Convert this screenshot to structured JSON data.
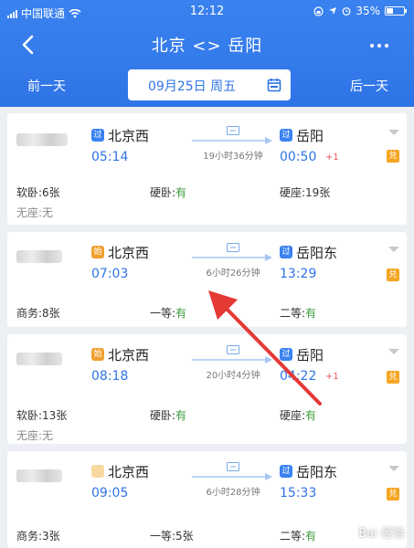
{
  "status_bar": {
    "carrier": "中国联通",
    "time": "12:12",
    "battery": "35%"
  },
  "header": {
    "title": "北京 <> 岳阳",
    "prev_day": "前一天",
    "next_day": "后一天",
    "date": "09月25日 周五"
  },
  "trains": [
    {
      "from_badge": "过",
      "from": "北京西",
      "depart": "05:14",
      "duration": "19小时36分钟",
      "to_badge": "过",
      "to": "岳阳",
      "arrive": "00:50",
      "plus": "+1",
      "dui": "兑",
      "seats": [
        {
          "label": "软卧:",
          "value": "6张"
        },
        {
          "label": "硬卧:",
          "value": "有"
        },
        {
          "label": "硬座:",
          "value": "19张"
        },
        {
          "label": "无座:",
          "value": "无"
        }
      ]
    },
    {
      "from_badge": "始",
      "from": "北京西",
      "depart": "07:03",
      "duration": "6小时26分钟",
      "to_badge": "过",
      "to": "岳阳东",
      "arrive": "13:29",
      "plus": "",
      "dui": "兑",
      "seats": [
        {
          "label": "商务:",
          "value": "8张"
        },
        {
          "label": "一等:",
          "value": "有"
        },
        {
          "label": "二等:",
          "value": "有"
        }
      ]
    },
    {
      "from_badge": "始",
      "from": "北京西",
      "depart": "08:18",
      "duration": "20小时4分钟",
      "to_badge": "过",
      "to": "岳阳",
      "arrive": "04:22",
      "plus": "+1",
      "dui": "兑",
      "seats": [
        {
          "label": "软卧:",
          "value": "13张"
        },
        {
          "label": "硬卧:",
          "value": "有"
        },
        {
          "label": "硬座:",
          "value": "有"
        },
        {
          "label": "无座:",
          "value": "无"
        }
      ]
    },
    {
      "from_badge": "",
      "from": "北京西",
      "depart": "09:05",
      "duration": "6小时28分钟",
      "to_badge": "过",
      "to": "岳阳东",
      "arrive": "15:33",
      "plus": "",
      "dui": "兑",
      "seats": [
        {
          "label": "商务:",
          "value": "3张"
        },
        {
          "label": "一等:",
          "value": "5张"
        },
        {
          "label": "二等:",
          "value": "有"
        }
      ]
    }
  ],
  "watermark": "Bai 经验",
  "colors": {
    "header": "#2f74e6",
    "accent": "#2f74e6",
    "available": "#3a9a3a",
    "badge_orange": "#f0a030",
    "pointer": "#e53935"
  }
}
